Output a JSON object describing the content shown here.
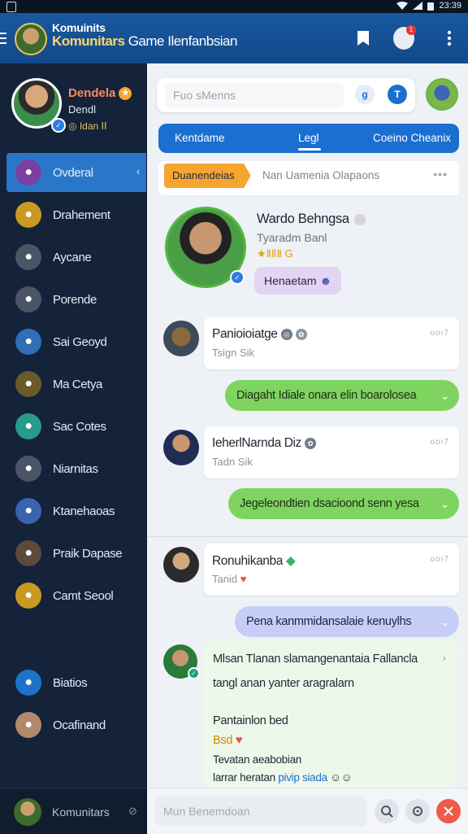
{
  "status_bar": {
    "time": "23:39"
  },
  "app_bar": {
    "title_top": "Komuinits",
    "brand": "Komunitars",
    "title": "Game Ilenfanbsian",
    "notification_count": "1"
  },
  "sidebar": {
    "profile": {
      "name": "Dendela",
      "role": "Dendl",
      "level": "Idan"
    },
    "items": [
      {
        "label": "Ovderal",
        "icon": "game-character-icon",
        "color": "#7b3fa0"
      },
      {
        "label": "Drahement",
        "icon": "treasure-icon",
        "color": "#c99a22"
      },
      {
        "label": "Aycane",
        "icon": "badge-icon",
        "color": "#4a5666"
      },
      {
        "label": "Porende",
        "icon": "chart-icon",
        "color": "#4a5666"
      },
      {
        "label": "Sai Geoyd",
        "icon": "avatar-icon",
        "color": "#2f6fb5"
      },
      {
        "label": "Ma Cetya",
        "icon": "sword-icon",
        "color": "#6b5a2a"
      },
      {
        "label": "Sac Cotes",
        "icon": "character-icon",
        "color": "#2a9a8a"
      },
      {
        "label": "Niarnitas",
        "icon": "calendar-icon",
        "color": "#4a5666"
      },
      {
        "label": "Ktanehaoas",
        "icon": "rocket-icon",
        "color": "#3a63b0"
      },
      {
        "label": "Praik Dapase",
        "icon": "profile-icon",
        "color": "#5c4a3a"
      },
      {
        "label": "Camt Seool",
        "icon": "trophy-icon",
        "color": "#c99a22"
      }
    ],
    "bottom_items": [
      {
        "label": "Biatios",
        "icon": "up-arrow-icon",
        "color": "#1f72c9"
      },
      {
        "label": "Ocafinand",
        "icon": "user-avatar-icon",
        "color": "#b08a6a"
      }
    ],
    "footer": {
      "label": "Komunitars"
    }
  },
  "main": {
    "search": {
      "placeholder": "Fuo sMenns"
    },
    "tabs": [
      "Kentdame",
      "Legl",
      "Coeino Cheanix"
    ],
    "active_tab": 1,
    "category": {
      "chip": "Duanendeias",
      "text": "Nan Uamenia Olapaons"
    },
    "featured": {
      "name": "Wardo Behngsa",
      "subtitle": "Tyaradm Banl",
      "rating": "★ⅡⅡⅡ G",
      "chip": "Henaetam"
    },
    "messages": [
      {
        "name": "Panioioiatge",
        "sub": "Tsign Sik",
        "time": "ooı7"
      },
      {
        "name": "IeherlNarnda Diz",
        "sub": "Tadn Sik",
        "time": "ooı7"
      },
      {
        "name": "Ronuhikanba",
        "sub": "Tanid",
        "time": "ooı7"
      }
    ],
    "bubbles": [
      "Diagaht Idiale onara elin boarolosea",
      "Jegeleondtien dsacioond senn yesa",
      "Pena kanmmidansalaie kenuylhs"
    ],
    "long_message": {
      "line1": "Mlsan Tlanan slamangenantaia Fallancla",
      "line2": "tangl anan yanter aragralarn",
      "line3": "Pantainlon bed",
      "line4": "Bsd",
      "line5": "Tevatan aeabobian",
      "line6_start": "larrar heratan",
      "line6_link": "pivip siada"
    },
    "composer": {
      "placeholder": "Mun Benemdoan"
    }
  },
  "colors": {
    "primary": "#1a6fd0",
    "accent": "#f6a531",
    "green": "#7fd460"
  }
}
